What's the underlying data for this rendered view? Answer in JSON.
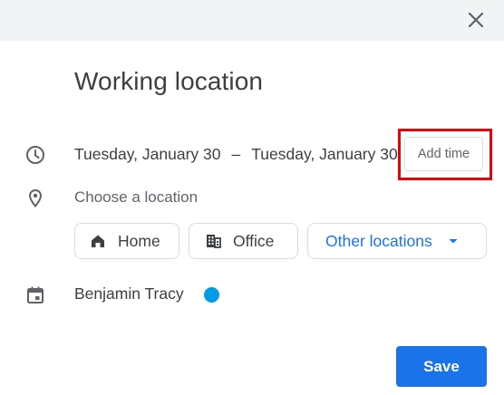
{
  "dialog": {
    "title": "Working location",
    "close_icon": "close-icon"
  },
  "time": {
    "icon": "clock-icon",
    "start_date": "Tuesday, January 30",
    "separator": "–",
    "end_date": "Tuesday, January 30",
    "add_time_label": "Add time"
  },
  "location": {
    "icon": "location-pin-icon",
    "placeholder": "Choose a location",
    "options": [
      {
        "label": "Home",
        "icon": "home-icon"
      },
      {
        "label": "Office",
        "icon": "office-building-icon"
      },
      {
        "label": "Other locations",
        "icon": "dropdown-caret-icon"
      }
    ]
  },
  "calendar": {
    "icon": "calendar-icon",
    "owner": "Benjamin Tracy",
    "color": "#039be5"
  },
  "footer": {
    "save_label": "Save"
  },
  "colors": {
    "accent": "#1a73e8",
    "highlight": "#e8000b",
    "topbar": "#f1f3f4"
  }
}
